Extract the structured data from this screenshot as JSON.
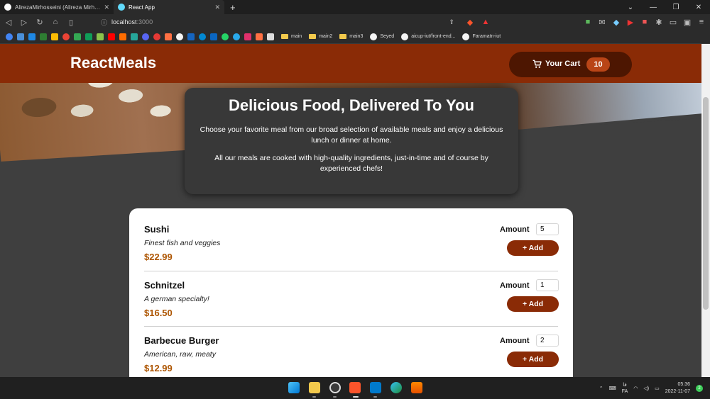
{
  "browser": {
    "tabs": [
      {
        "title": "AlirezaMirhosseini (Alireza Mirhosseini)",
        "active": false
      },
      {
        "title": "React App",
        "active": true
      }
    ],
    "new_tab": "+",
    "address": {
      "host": "localhost",
      "port": ":3000"
    },
    "bookmarks": {
      "folders": [
        "main",
        "main2",
        "main3"
      ],
      "links": [
        "Seyed",
        "aicup-iut/front-end...",
        "Faramatn-iut"
      ]
    }
  },
  "app": {
    "brand": "ReactMeals",
    "cart": {
      "label": "Your Cart",
      "count": "10"
    },
    "summary": {
      "title": "Delicious Food, Delivered To You",
      "paragraph1": "Choose your favorite meal from our broad selection of available meals and enjoy a delicious lunch or dinner at home.",
      "paragraph2": "All our meals are cooked with high-quality ingredients, just-in-time and of course by experienced chefs!"
    },
    "meals": [
      {
        "name": "Sushi",
        "description": "Finest fish and veggies",
        "price": "$22.99",
        "amount_label": "Amount",
        "amount": "5",
        "add_label": "+ Add"
      },
      {
        "name": "Schnitzel",
        "description": "A german specialty!",
        "price": "$16.50",
        "amount_label": "Amount",
        "amount": "1",
        "add_label": "+ Add"
      },
      {
        "name": "Barbecue Burger",
        "description": "American, raw, meaty",
        "price": "$12.99",
        "amount_label": "Amount",
        "amount": "2",
        "add_label": "+ Add"
      }
    ]
  },
  "taskbar": {
    "language": {
      "top": "فا",
      "bottom": "FA"
    },
    "time": "05:36",
    "date": "2022-11-07",
    "notifications": "2"
  },
  "colors": {
    "header": "#8a2b06",
    "cart_button": "#4d1601",
    "cart_badge": "#b94517",
    "price": "#ad5502",
    "page_bg": "#3f3f3f"
  }
}
